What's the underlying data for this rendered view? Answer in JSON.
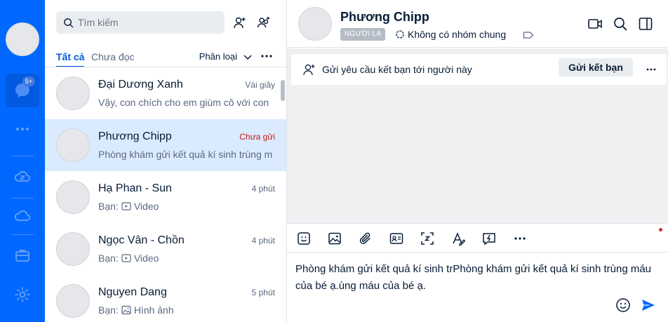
{
  "rail": {
    "badge": "5+",
    "icons": [
      "user-avatar",
      "message-icon",
      "more-icon",
      "zcloud-icon",
      "cloud-icon",
      "briefcase-icon",
      "settings-icon"
    ]
  },
  "list": {
    "search_placeholder": "Tìm kiếm",
    "tabs": [
      "Tất cả",
      "Chưa đọc"
    ],
    "classify_label": "Phân loại",
    "conversations": [
      {
        "name": "Đại Dương Xanh",
        "time": "Vài giây",
        "preview": "Vậy, con chích cho em giùm cô với con",
        "unread": false
      },
      {
        "name": "Phương Chipp",
        "time": "Chưa gửi",
        "preview": "Phòng khám gửi kết quả kí sinh trùng m",
        "unread": true
      },
      {
        "name": "Hạ Phan - Sun",
        "time": "4 phút",
        "prefix": "Bạn:",
        "preview": "Video",
        "preview_icon": "video-icon"
      },
      {
        "name": "Ngọc Vân - Chồn",
        "time": "4 phút",
        "prefix": "Bạn:",
        "preview": "Video",
        "preview_icon": "video-icon"
      },
      {
        "name": "Nguyen Dang",
        "time": "5 phút",
        "prefix": "Bạn:",
        "preview": "Hình ảnh",
        "preview_icon": "image-icon"
      }
    ]
  },
  "chat": {
    "title": "Phương Chipp",
    "stranger_tag": "NGƯỜI LẠ",
    "group_info": "Không có nhóm chung",
    "friend_request_text": "Gửi yêu cầu kết bạn tới người này",
    "friend_button": "Gửi kết bạn",
    "composer_text": "Phòng khám gửi kết quả kí sinh trPhòng khám gửi kết quả kí sinh trùng máu của bé ạ.ùng máu của bé ạ."
  },
  "colors": {
    "accent": "#0068ff",
    "selected_row": "#dbebff",
    "unread_time": "#c31a1a",
    "chat_bg": "#eef0f1"
  }
}
